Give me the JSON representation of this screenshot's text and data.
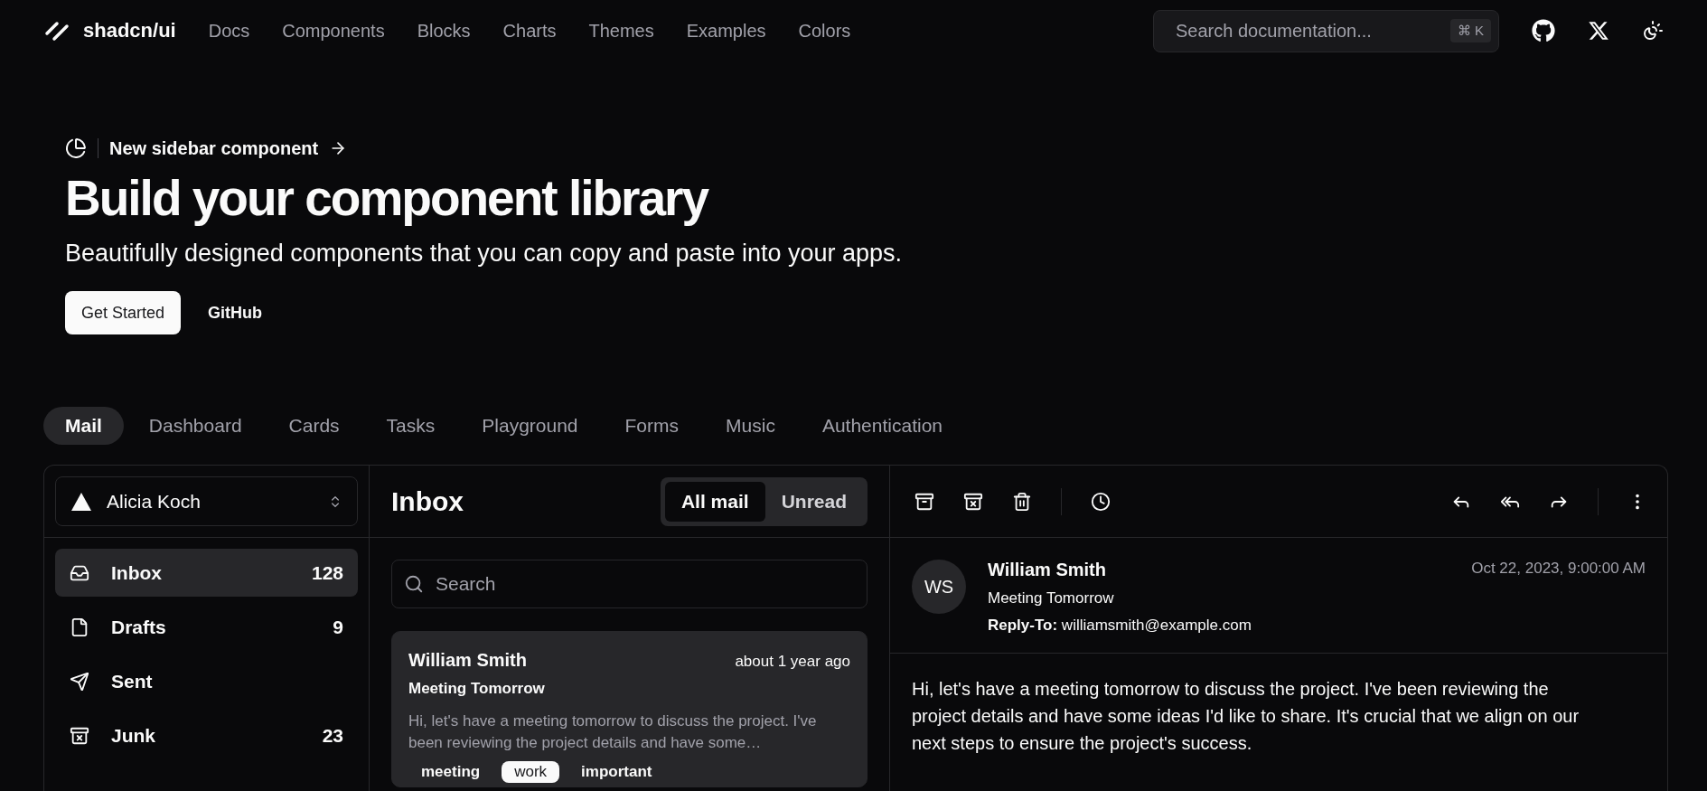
{
  "nav": {
    "logo": "shadcn/ui",
    "links": [
      {
        "label": "Docs"
      },
      {
        "label": "Components"
      },
      {
        "label": "Blocks"
      },
      {
        "label": "Charts"
      },
      {
        "label": "Themes"
      },
      {
        "label": "Examples"
      },
      {
        "label": "Colors"
      }
    ],
    "search": {
      "placeholder": "Search documentation...",
      "shortcut": "⌘ K"
    }
  },
  "hero": {
    "announcement": "New sidebar component",
    "title": "Build your component library",
    "subtitle": "Beautifully designed components that you can copy and paste into your apps.",
    "buttons": [
      {
        "label": "Get Started",
        "kind": "primary"
      },
      {
        "label": "GitHub",
        "kind": "ghost"
      }
    ]
  },
  "example_tabs": [
    {
      "label": "Mail",
      "selected": true
    },
    {
      "label": "Dashboard",
      "selected": false
    },
    {
      "label": "Cards",
      "selected": false
    },
    {
      "label": "Tasks",
      "selected": false
    },
    {
      "label": "Playground",
      "selected": false
    },
    {
      "label": "Forms",
      "selected": false
    },
    {
      "label": "Music",
      "selected": false
    },
    {
      "label": "Authentication",
      "selected": false
    }
  ],
  "mail": {
    "account": {
      "name": "Alicia Koch"
    },
    "folders": [
      {
        "label": "Inbox",
        "count": "128",
        "selected": true
      },
      {
        "label": "Drafts",
        "count": "9",
        "selected": false
      },
      {
        "label": "Sent",
        "selected": false
      },
      {
        "label": "Junk",
        "count": "23",
        "selected": false
      }
    ],
    "list": {
      "title": "Inbox",
      "filters": [
        {
          "label": "All mail",
          "selected": true
        },
        {
          "label": "Unread",
          "selected": false
        }
      ],
      "search": {
        "placeholder": "Search"
      },
      "messages": [
        {
          "sender": "William Smith",
          "time": "about 1 year ago",
          "subject": "Meeting Tomorrow",
          "preview": "Hi, let's have a meeting tomorrow to discuss the project. I've been reviewing the project details and have some…",
          "selected": true,
          "tags": [
            {
              "label": "meeting",
              "kind": "plain"
            },
            {
              "label": "work",
              "kind": "highlight"
            },
            {
              "label": "important",
              "kind": "plain"
            }
          ]
        }
      ]
    },
    "reader": {
      "initials": "WS",
      "sender": "William Smith",
      "subject": "Meeting Tomorrow",
      "reply_to": "**Reply-To:** williamsmith@example.com",
      "date": "Oct 22, 2023, 9:00:00 AM",
      "body": "Hi, let's have a meeting tomorrow to discuss the project. I've been reviewing the project details and have some ideas I'd like to share. It's crucial that we align on our next steps to ensure the project's success."
    }
  }
}
